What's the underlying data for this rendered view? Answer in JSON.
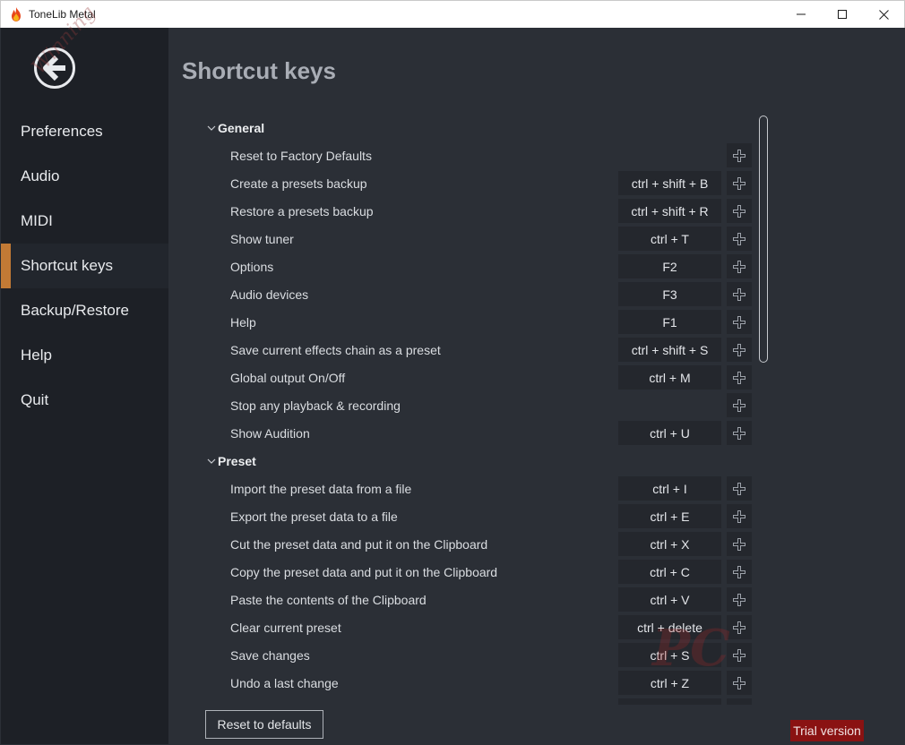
{
  "window": {
    "title": "ToneLib Metal",
    "controls": [
      "minimize-icon",
      "maximize-icon",
      "close-icon"
    ]
  },
  "sidebar": {
    "items": [
      {
        "label": "Preferences",
        "active": false
      },
      {
        "label": "Audio",
        "active": false
      },
      {
        "label": "MIDI",
        "active": false
      },
      {
        "label": "Shortcut keys",
        "active": true
      },
      {
        "label": "Backup/Restore",
        "active": false
      },
      {
        "label": "Help",
        "active": false
      },
      {
        "label": "Quit",
        "active": false
      }
    ],
    "watermark": "Winning"
  },
  "main": {
    "title": "Shortcut keys",
    "groups": [
      {
        "name": "General",
        "rows": [
          {
            "label": "Reset to Factory Defaults",
            "key": ""
          },
          {
            "label": "Create a presets backup",
            "key": "ctrl + shift + B"
          },
          {
            "label": "Restore a presets backup",
            "key": "ctrl + shift + R"
          },
          {
            "label": "Show tuner",
            "key": "ctrl + T"
          },
          {
            "label": "Options",
            "key": "F2"
          },
          {
            "label": "Audio devices",
            "key": "F3"
          },
          {
            "label": "Help",
            "key": "F1"
          },
          {
            "label": "Save current effects chain as a preset",
            "key": "ctrl + shift + S"
          },
          {
            "label": "Global output On/Off",
            "key": "ctrl + M"
          },
          {
            "label": "Stop any playback & recording",
            "key": ""
          },
          {
            "label": "Show Audition",
            "key": "ctrl + U"
          }
        ]
      },
      {
        "name": "Preset",
        "rows": [
          {
            "label": "Import the preset data from a file",
            "key": "ctrl + I"
          },
          {
            "label": "Export the preset data to a file",
            "key": "ctrl + E"
          },
          {
            "label": "Cut the preset data and put it on the Clipboard",
            "key": "ctrl + X"
          },
          {
            "label": "Copy the preset data and put it on the Clipboard",
            "key": "ctrl + C"
          },
          {
            "label": "Paste the contents of the Clipboard",
            "key": "ctrl + V"
          },
          {
            "label": "Clear current preset",
            "key": "ctrl + delete"
          },
          {
            "label": "Save changes",
            "key": "ctrl + S"
          },
          {
            "label": "Undo a last change",
            "key": "ctrl + Z"
          },
          {
            "label": "",
            "key": ""
          }
        ]
      }
    ],
    "reset_button": "Reset to defaults",
    "trial_badge": "Trial version",
    "watermark": "PC"
  },
  "colors": {
    "sidebar_bg": "#1d2026",
    "main_bg": "#2b2f36",
    "accent": "#c27a35",
    "trial_bg": "#8a1212"
  }
}
